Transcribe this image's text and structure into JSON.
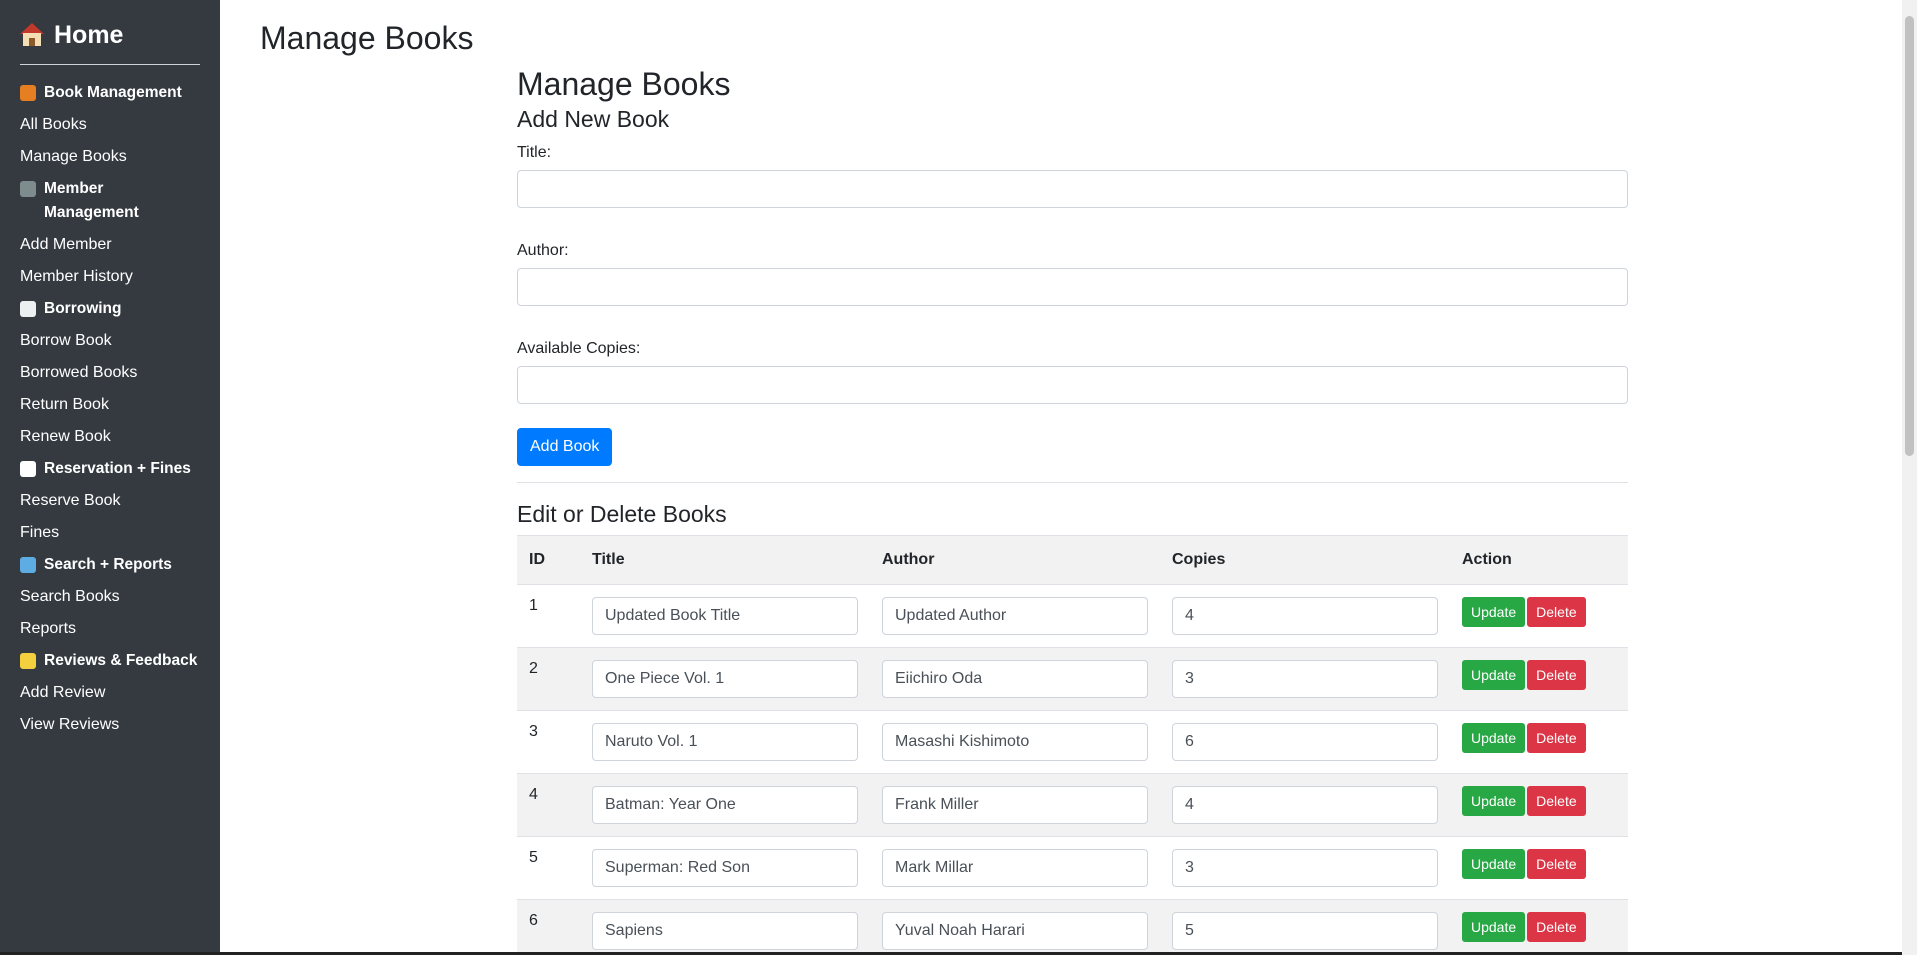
{
  "sidebar": {
    "home_label": "Home",
    "home_icon": "house-icon",
    "sections": [
      {
        "label": "Book Management",
        "icon": "books-icon",
        "icon_color": "#e67e22",
        "items": [
          "All Books",
          "Manage Books"
        ]
      },
      {
        "label": "Member Management",
        "icon": "members-icon",
        "icon_color": "#7f8c8d",
        "items": [
          "Add Member",
          "Member History"
        ]
      },
      {
        "label": "Borrowing",
        "icon": "open-book-icon",
        "icon_color": "#ecf0f1",
        "items": [
          "Borrow Book",
          "Borrowed Books",
          "Return Book",
          "Renew Book"
        ]
      },
      {
        "label": "Reservation + Fines",
        "icon": "clock-icon",
        "icon_color": "#ffffff",
        "items": [
          "Reserve Book",
          "Fines"
        ]
      },
      {
        "label": "Search + Reports",
        "icon": "magnifier-icon",
        "icon_color": "#5dade2",
        "items": [
          "Search Books",
          "Reports"
        ]
      },
      {
        "label": "Reviews & Feedback",
        "icon": "memo-icon",
        "icon_color": "#f4d03f",
        "items": [
          "Add Review",
          "View Reviews"
        ]
      }
    ]
  },
  "page": {
    "title": "Manage Books"
  },
  "main": {
    "heading": "Manage Books",
    "add_heading": "Add New Book",
    "form": {
      "title_label": "Title:",
      "author_label": "Author:",
      "copies_label": "Available Copies:",
      "title_value": "",
      "author_value": "",
      "copies_value": "",
      "submit_label": "Add Book"
    },
    "edit_heading": "Edit or Delete Books",
    "table": {
      "headers": [
        "ID",
        "Title",
        "Author",
        "Copies",
        "Action"
      ],
      "update_label": "Update",
      "delete_label": "Delete",
      "rows": [
        {
          "id": "1",
          "title": "Updated Book Title",
          "author": "Updated Author",
          "copies": "4"
        },
        {
          "id": "2",
          "title": "One Piece Vol. 1",
          "author": "Eiichiro Oda",
          "copies": "3"
        },
        {
          "id": "3",
          "title": "Naruto Vol. 1",
          "author": "Masashi Kishimoto",
          "copies": "6"
        },
        {
          "id": "4",
          "title": "Batman: Year One",
          "author": "Frank Miller",
          "copies": "4"
        },
        {
          "id": "5",
          "title": "Superman: Red Son",
          "author": "Mark Millar",
          "copies": "3"
        },
        {
          "id": "6",
          "title": "Sapiens",
          "author": "Yuval Noah Harari",
          "copies": "5"
        }
      ]
    }
  },
  "colors": {
    "sidebar_bg": "#343a40",
    "primary": "#007bff",
    "success": "#28a745",
    "danger": "#dc3545"
  }
}
